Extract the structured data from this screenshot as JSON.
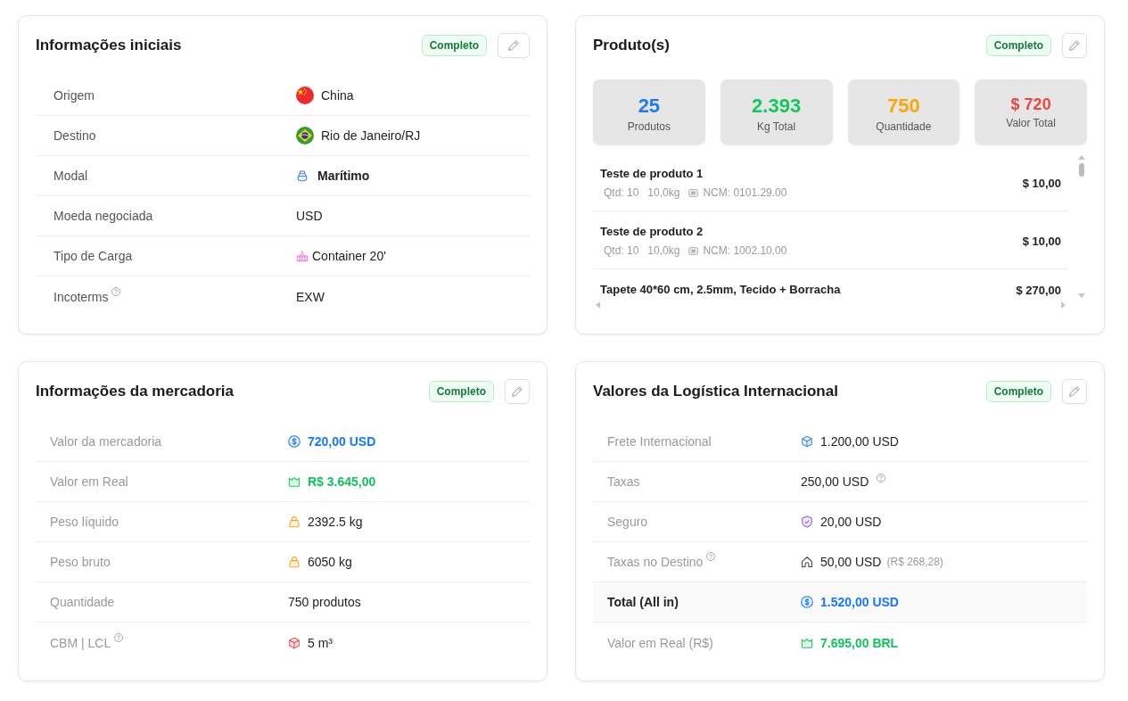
{
  "cards": [
    {
      "kind": "details",
      "title": "Informações iniciais",
      "status": "Completo",
      "rows": [
        {
          "label": "Origem",
          "help": false,
          "kind": "china",
          "value": "China",
          "bold": false
        },
        {
          "label": "Destino",
          "help": false,
          "kind": "brazil",
          "value": "Rio de Janeiro/RJ",
          "bold": false
        },
        {
          "label": "Modal",
          "help": false,
          "kind": "ship",
          "value": "Marítimo",
          "bold": true
        },
        {
          "label": "Moeda negociada",
          "help": false,
          "kind": "text",
          "value": "USD",
          "bold": false
        },
        {
          "label": "Tipo de Carga",
          "help": false,
          "kind": "crate",
          "value": "Container 20'",
          "bold": false
        },
        {
          "label": "Incoterms",
          "help": true,
          "kind": "text",
          "value": "EXW",
          "bold": false
        }
      ]
    },
    {
      "kind": "products",
      "title": "Produto(s)",
      "status": "Completo",
      "stats": [
        {
          "kind": "count",
          "value": "25",
          "label": "Produtos",
          "color": "#1f7bf2"
        },
        {
          "kind": "count",
          "value": "2.393",
          "label": "Kg Total",
          "color": "#12c85a"
        },
        {
          "kind": "count",
          "value": "750",
          "label": "Quantidade",
          "color": "#f5a90f"
        },
        {
          "kind": "money",
          "value": "$ 720",
          "label": "Valor Total",
          "color": "#ef4444"
        }
      ],
      "items": [
        {
          "name": "Teste de produto 1",
          "qty": "Qtd: 10",
          "weight": "10,0kg",
          "ncm": "NCM: 0101.29.00",
          "price": "$ 10,00"
        },
        {
          "name": "Teste de produto 2",
          "qty": "Qtd: 10",
          "weight": "10,0kg",
          "ncm": "NCM: 1002.10.00",
          "price": "$ 10,00"
        },
        {
          "name": "Tapete 40*60 cm, 2.5mm, Tecido + Borracha",
          "price": "$ 270,00"
        }
      ]
    },
    {
      "kind": "details",
      "title": "Informações da mercadoria",
      "status": "Completo",
      "rows": [
        {
          "label": "Valor da mercadoria",
          "help": false,
          "kind": "dollar",
          "value": "720,00 USD",
          "bold": true,
          "color": "#1677ff"
        },
        {
          "label": "Valor em Real",
          "help": false,
          "kind": "money",
          "value": "R$ 3.645,00",
          "bold": true,
          "color": "#13c25b"
        },
        {
          "label": "Peso líquido",
          "help": false,
          "kind": "weight",
          "value": "2392.5 kg",
          "bold": false
        },
        {
          "label": "Peso bruto",
          "help": false,
          "kind": "weight",
          "value": "6050 kg",
          "bold": false
        },
        {
          "label": "Quantidade",
          "help": false,
          "kind": "text",
          "value": "750 produtos",
          "bold": false
        },
        {
          "label": "CBM | LCL",
          "help": true,
          "kind": "volume",
          "value": "5 m³",
          "bold": false
        }
      ]
    },
    {
      "kind": "details",
      "title": "Valores da Logística Internacional",
      "status": "Completo",
      "rows": [
        {
          "label": "Frete Internacional",
          "help": false,
          "highlighted": false,
          "kind": "freight",
          "value": "1.200,00 USD",
          "bold": false,
          "value_help": false
        },
        {
          "label": "Taxas",
          "help": false,
          "highlighted": false,
          "kind": "text",
          "value": "250,00 USD",
          "bold": false,
          "value_help": true
        },
        {
          "label": "Seguro",
          "help": false,
          "highlighted": false,
          "kind": "shield",
          "value": "20,00 USD",
          "bold": false,
          "value_help": false
        },
        {
          "label": "Taxas no Destino",
          "help": true,
          "highlighted": false,
          "kind": "house",
          "value": "50,00 USD",
          "note": "(R$ 268,28)",
          "bold": false,
          "value_help": false
        },
        {
          "label": "Total (All in)",
          "help": false,
          "highlighted": true,
          "kind": "dollar",
          "value": "1.520,00 USD",
          "bold": true,
          "color": "#1677ff",
          "value_help": false
        },
        {
          "label": "Valor em Real (R$)",
          "help": false,
          "highlighted": false,
          "kind": "money",
          "value": "7.695,00 BRL",
          "bold": true,
          "color": "#13c25b",
          "value_help": false
        }
      ]
    }
  ]
}
